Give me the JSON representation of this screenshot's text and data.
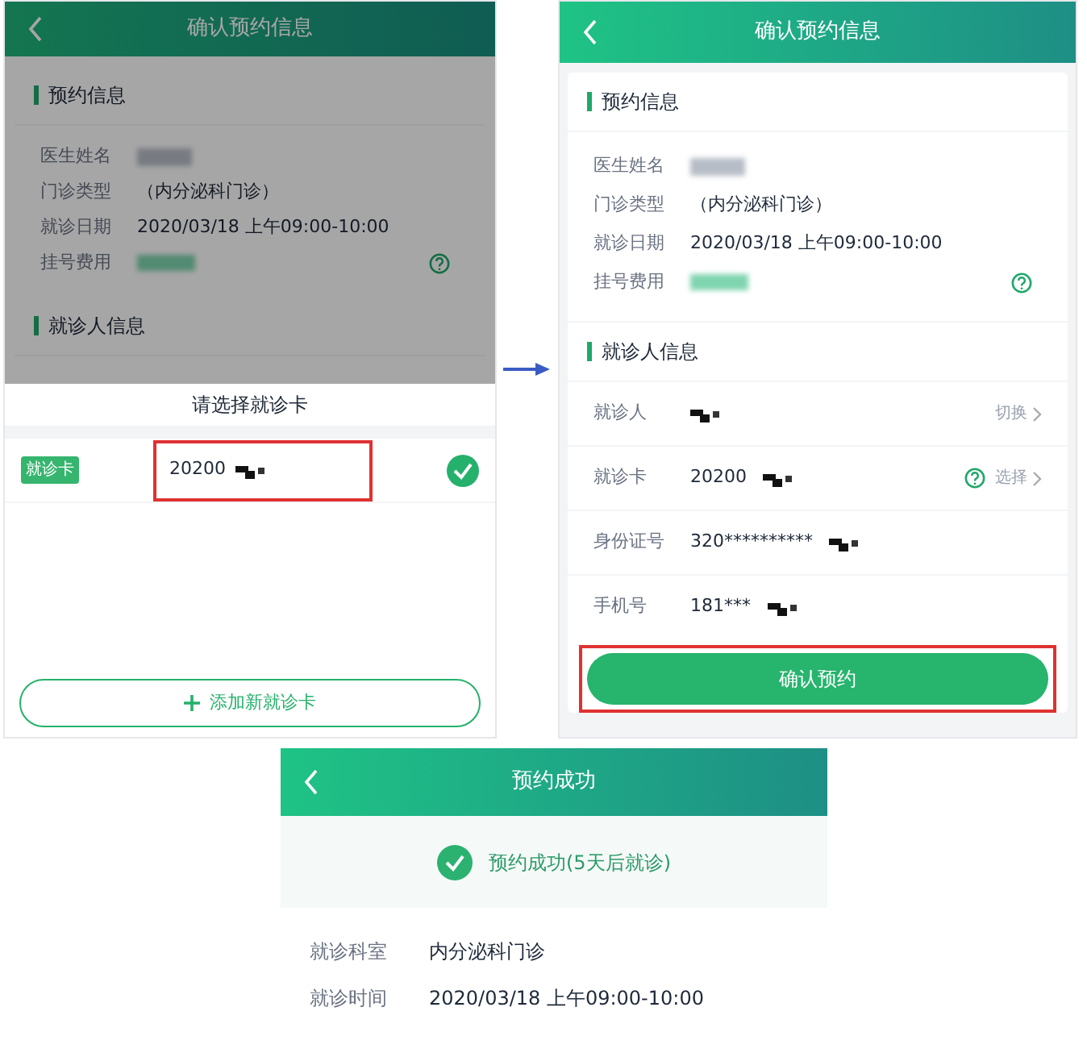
{
  "select_card_screen": {
    "title": "确认预约信息",
    "appointment_section": {
      "heading": "预约信息",
      "rows": [
        {
          "label": "医生姓名",
          "kind": "blur"
        },
        {
          "label": "门诊类型",
          "value": "（内分泌科门诊）",
          "kind": "plain"
        },
        {
          "label": "就诊日期",
          "value": "2020/03/18 上午09:00-10:00",
          "kind": "plain"
        },
        {
          "label": "挂号费用",
          "kind": "tint",
          "help": true
        }
      ]
    },
    "patient_section": {
      "heading": "就诊人信息"
    },
    "sheet": {
      "title": "请选择就诊卡",
      "cards": [
        {
          "tag": "就诊卡",
          "number": "20200",
          "selected": true,
          "highlighted": true
        }
      ],
      "add_button": "添加新就诊卡"
    }
  },
  "confirm_screen": {
    "title": "确认预约信息",
    "appointment_section": {
      "heading": "预约信息",
      "rows": [
        {
          "label": "医生姓名",
          "kind": "blur"
        },
        {
          "label": "门诊类型",
          "value": "（内分泌科门诊）",
          "kind": "plain"
        },
        {
          "label": "就诊日期",
          "value": "2020/03/18 上午09:00-10:00",
          "kind": "plain"
        },
        {
          "label": "挂号费用",
          "kind": "tint",
          "help": true
        }
      ]
    },
    "patient_section": {
      "heading": "就诊人信息",
      "rows": [
        {
          "label": "就诊人",
          "kind": "pixel",
          "action": "切换"
        },
        {
          "label": "就诊卡",
          "value": "20200",
          "kind": "pixel",
          "help": true,
          "action": "选择"
        },
        {
          "label": "身份证号",
          "value": "320**********",
          "kind": "pixel"
        },
        {
          "label": "手机号",
          "value": "181***",
          "kind": "pixel"
        }
      ]
    },
    "confirm_button": {
      "label": "确认预约",
      "highlighted": true
    }
  },
  "success_screen": {
    "title": "预约成功",
    "message": "预约成功(5天后就诊)",
    "details": [
      {
        "label": "就诊科室",
        "value": "内分泌科门诊"
      },
      {
        "label": "就诊时间",
        "value": "2020/03/18 上午09:00-10:00"
      }
    ]
  }
}
